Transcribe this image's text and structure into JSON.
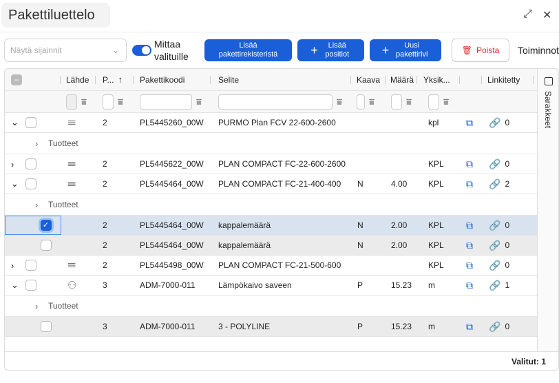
{
  "title": "Pakettiluettelo",
  "toolbar": {
    "location_placeholder": "Näytä sijainnit",
    "toggle_label": "Mittaa valituille",
    "add_from_registry": "Lisää pakettirekisteristä",
    "add_positions": "Lisää positiot",
    "new_row": "Uusi pakettirivi",
    "delete": "Poista",
    "actions": "Toiminnot"
  },
  "columns": {
    "source": "Lähde",
    "p": "P...",
    "code": "Pakettikoodi",
    "desc": "Selite",
    "formula": "Kaava",
    "qty": "Määrä",
    "unit": "Yksik...",
    "linked": "Linkitetty"
  },
  "side_panel": "Sarakkeet",
  "footer": "Valitut: 1",
  "rows": [
    {
      "type": "parent",
      "expanded": true,
      "icon": "library",
      "p": "2",
      "code": "PL5445260_00W",
      "desc": "PURMO Plan FCV 22-600-2600",
      "formula": "",
      "qty": "",
      "unit": "kpl",
      "linked": "0"
    },
    {
      "type": "products",
      "label": "Tuotteet"
    },
    {
      "type": "parent",
      "expanded": false,
      "icon": "library",
      "p": "2",
      "code": "PL5445622_00W",
      "desc": "PLAN COMPACT FC-22-600-2600",
      "formula": "",
      "qty": "",
      "unit": "KPL",
      "linked": "0"
    },
    {
      "type": "parent",
      "expanded": true,
      "icon": "library",
      "p": "2",
      "code": "PL5445464_00W",
      "desc": "PLAN COMPACT FC-21-400-400",
      "formula": "N",
      "qty": "4.00",
      "unit": "KPL",
      "linked": "2"
    },
    {
      "type": "products",
      "label": "Tuotteet"
    },
    {
      "type": "child",
      "selected": true,
      "p": "2",
      "code": "PL5445464_00W",
      "desc": "kappalemäärä",
      "formula": "N",
      "qty": "2.00",
      "unit": "KPL",
      "linked": "0"
    },
    {
      "type": "child",
      "selected": false,
      "p": "2",
      "code": "PL5445464_00W",
      "desc": "kappalemäärä",
      "formula": "N",
      "qty": "2.00",
      "unit": "KPL",
      "linked": "0"
    },
    {
      "type": "parent",
      "expanded": false,
      "icon": "library",
      "p": "2",
      "code": "PL5445498_00W",
      "desc": "PLAN COMPACT FC-21-500-600",
      "formula": "",
      "qty": "",
      "unit": "KPL",
      "linked": "0"
    },
    {
      "type": "parent",
      "expanded": true,
      "icon": "user",
      "p": "3",
      "code": "ADM-7000-011",
      "desc": "Lämpökaivo saveen",
      "formula": "P",
      "qty": "15.23",
      "unit": "m",
      "linked": "1"
    },
    {
      "type": "products",
      "label": "Tuotteet"
    },
    {
      "type": "child",
      "selected": false,
      "p": "3",
      "code": "ADM-7000-011",
      "desc": "3 - POLYLINE",
      "formula": "P",
      "qty": "15.23",
      "unit": "m",
      "linked": "0"
    }
  ]
}
